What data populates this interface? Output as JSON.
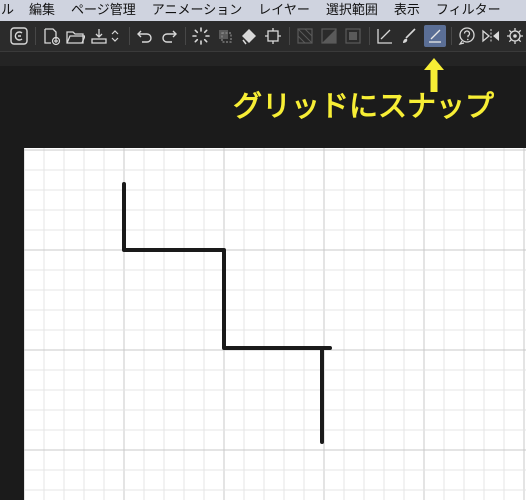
{
  "menubar": {
    "items": [
      "ル",
      "編集",
      "ページ管理",
      "アニメーション",
      "レイヤー",
      "選択範囲",
      "表示",
      "フィルター"
    ]
  },
  "toolbar": {
    "tools": [
      {
        "name": "app-logo-icon"
      },
      {
        "name": "new-file-icon"
      },
      {
        "name": "open-folder-icon"
      },
      {
        "name": "save-icon"
      },
      {
        "name": "undo-icon"
      },
      {
        "name": "redo-icon"
      },
      {
        "name": "loading-spinner-icon"
      },
      {
        "name": "transform-icon"
      },
      {
        "name": "fill-icon"
      },
      {
        "name": "crop-icon"
      },
      {
        "name": "snap-ruler-icon"
      },
      {
        "name": "snap-brush-icon"
      },
      {
        "name": "snap-to-grid-icon",
        "active": true
      },
      {
        "name": "help-icon"
      },
      {
        "name": "flip-horizontal-icon"
      },
      {
        "name": "settings-icon"
      }
    ]
  },
  "annotation": {
    "label": "グリッドにスナップ",
    "color": "#f7ee35"
  },
  "colors": {
    "menubar_bg": "#cfd3df",
    "toolbar_bg": "#2b2b2b",
    "active_tool_bg": "#5b6f96",
    "canvas_bg": "#ffffff",
    "grid_line": "#dcdcdc",
    "stroke": "#1a1a1a"
  }
}
